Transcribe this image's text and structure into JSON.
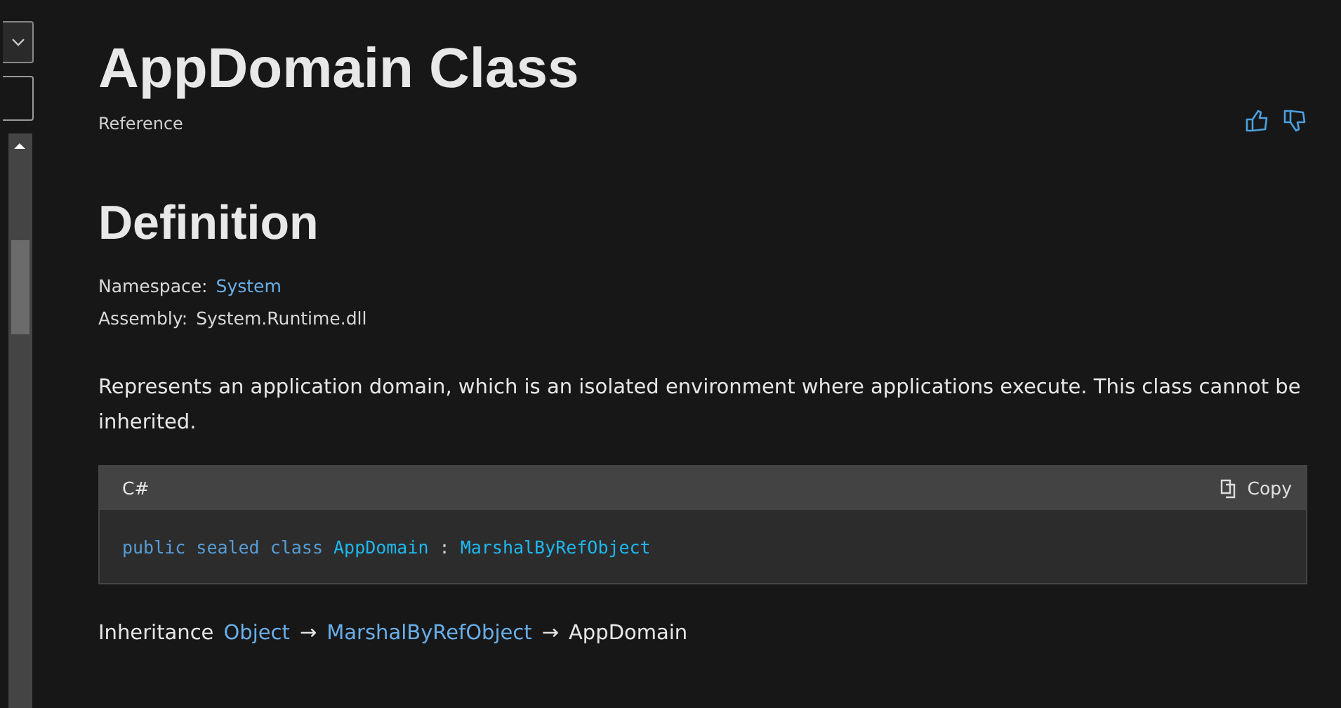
{
  "sidebar": {
    "dropdown": {
      "expanded": false
    }
  },
  "header": {
    "title": "AppDomain Class",
    "subtitle": "Reference"
  },
  "definition": {
    "heading": "Definition",
    "facts": [
      {
        "label": "Namespace:",
        "value": "System",
        "kind": "link"
      },
      {
        "label": "Assembly:",
        "value": "System.Runtime.dll",
        "kind": "text"
      }
    ],
    "summary": "Represents an application domain, which is an isolated environment where applications execute. This class cannot be inherited."
  },
  "code": {
    "language": "C#",
    "copy": "Copy",
    "tokens": [
      {
        "text": "public sealed class",
        "kind": "keyword"
      },
      {
        "text": "AppDomain",
        "kind": "type"
      },
      {
        "text": ":",
        "kind": "plain"
      },
      {
        "text": "MarshalByRefObject",
        "kind": "type"
      }
    ]
  },
  "inheritance": {
    "label": "Inheritance",
    "items": [
      {
        "text": "Object",
        "kind": "link"
      },
      {
        "text": "→",
        "kind": "arrow"
      },
      {
        "text": "MarshalByRefObject",
        "kind": "link"
      },
      {
        "text": "→",
        "kind": "arrow"
      },
      {
        "text": "AppDomain",
        "kind": "text"
      }
    ]
  }
}
